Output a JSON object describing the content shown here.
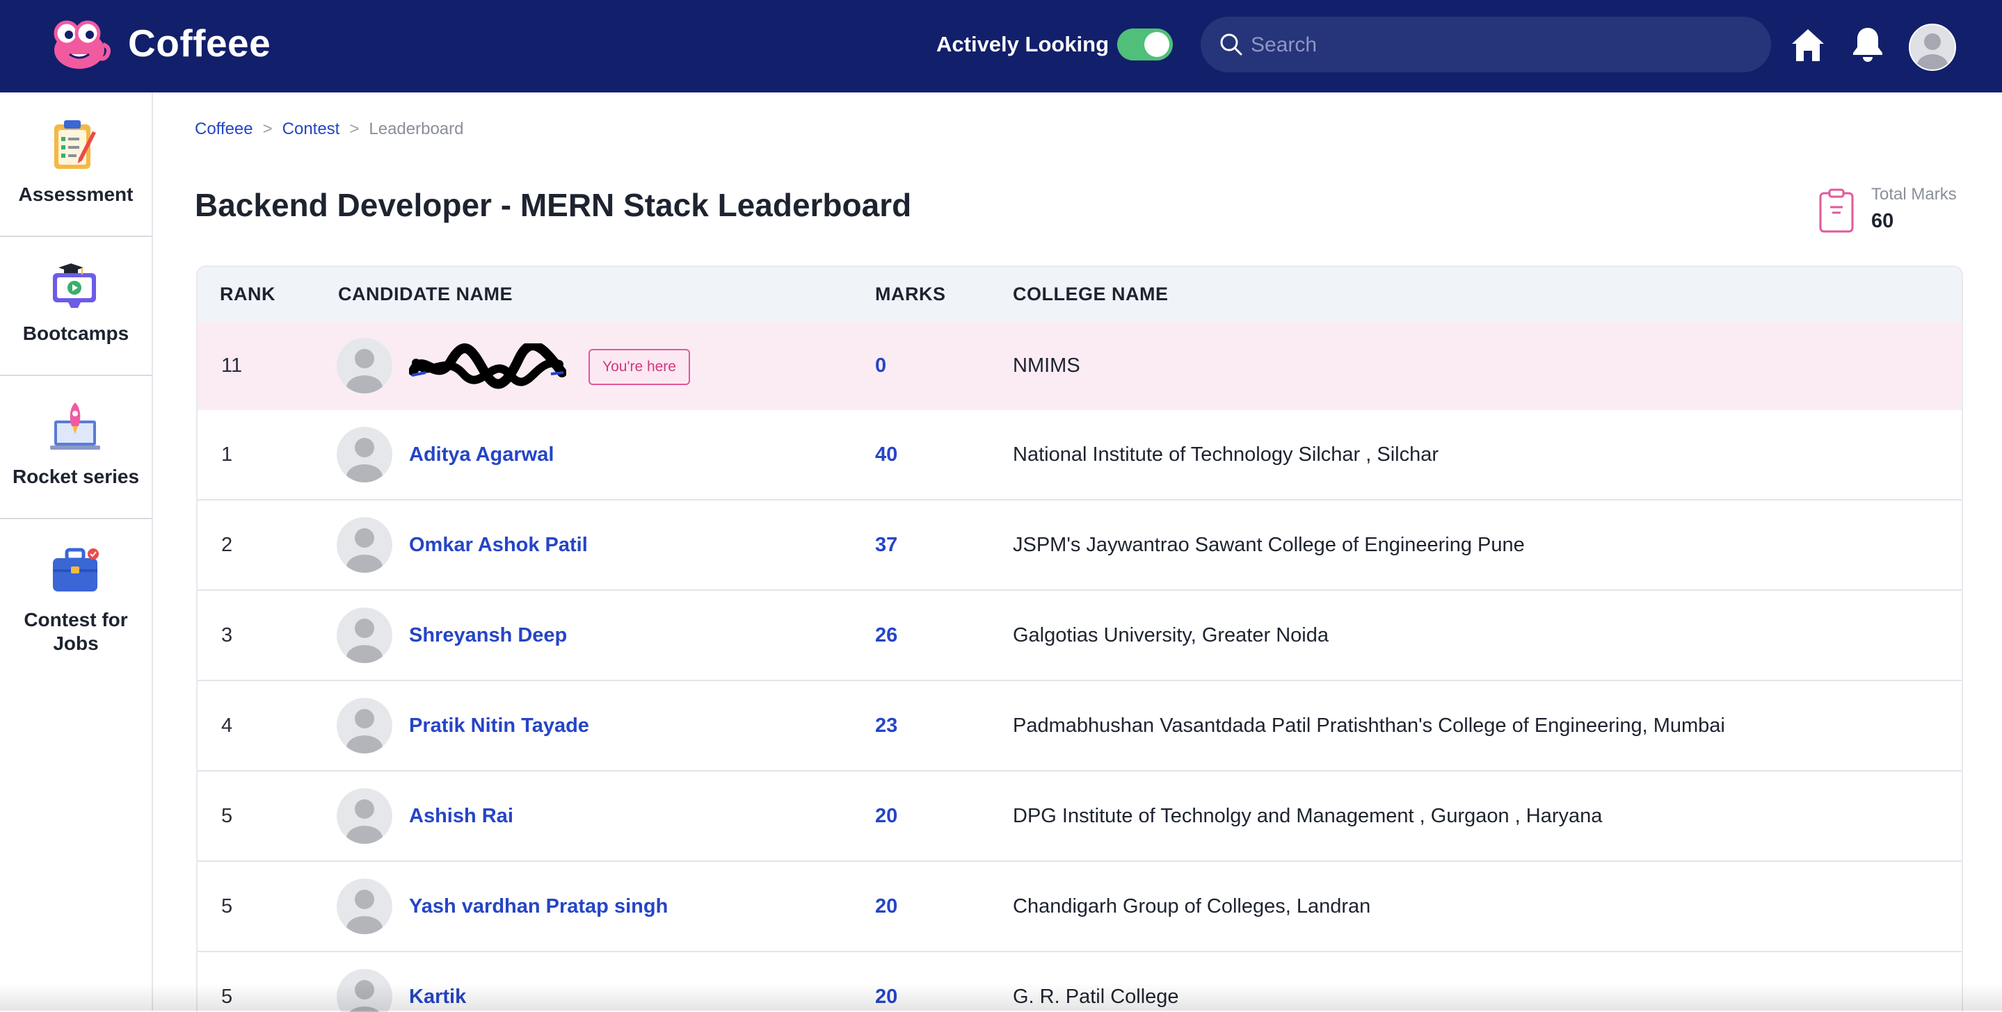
{
  "app": {
    "name": "Coffeee"
  },
  "header": {
    "status_label": "Actively Looking",
    "status_on": true,
    "search_placeholder": "Search",
    "search_value": ""
  },
  "sidebar": {
    "items": [
      {
        "label": "Assessment",
        "icon": "clipboard-checklist-icon"
      },
      {
        "label": "Bootcamps",
        "icon": "bootcamp-video-icon"
      },
      {
        "label": "Rocket series",
        "icon": "rocket-laptop-icon"
      },
      {
        "label": "Contest for Jobs",
        "icon": "briefcase-icon"
      }
    ]
  },
  "breadcrumb": [
    "Coffeee",
    "Contest",
    "Leaderboard"
  ],
  "page": {
    "title": "Backend Developer - MERN Stack Leaderboard",
    "total_marks_label": "Total Marks",
    "total_marks_value": "60"
  },
  "table": {
    "headers": [
      "RANK",
      "CANDIDATE NAME",
      "MARKS",
      "COLLEGE NAME"
    ],
    "current_user": {
      "rank": "11",
      "name": "",
      "badge": "You're here",
      "marks": "0",
      "college": "NMIMS"
    },
    "rows": [
      {
        "rank": "1",
        "name": "Aditya Agarwal",
        "marks": "40",
        "college": "National Institute of Technology Silchar , Silchar"
      },
      {
        "rank": "2",
        "name": "Omkar Ashok Patil",
        "marks": "37",
        "college": "JSPM's Jaywantrao Sawant College of Engineering Pune"
      },
      {
        "rank": "3",
        "name": "Shreyansh Deep",
        "marks": "26",
        "college": "Galgotias University, Greater Noida"
      },
      {
        "rank": "4",
        "name": "Pratik Nitin Tayade",
        "marks": "23",
        "college": "Padmabhushan Vasantdada Patil Pratishthan's College of Engineering, Mumbai"
      },
      {
        "rank": "5",
        "name": "Ashish Rai",
        "marks": "20",
        "college": "DPG Institute of Technolgy and Management , Gurgaon , Haryana"
      },
      {
        "rank": "5",
        "name": "Yash vardhan Pratap singh",
        "marks": "20",
        "college": "Chandigarh Group of Colleges, Landran"
      },
      {
        "rank": "5",
        "name": "Kartik",
        "marks": "20",
        "college": "G. R. Patil College"
      }
    ]
  },
  "colors": {
    "topbar": "#121f6b",
    "accent_link": "#2545c7",
    "toggle_on": "#4fbf7a",
    "highlight_row": "#fbecf4",
    "badge": "#e0599a"
  }
}
